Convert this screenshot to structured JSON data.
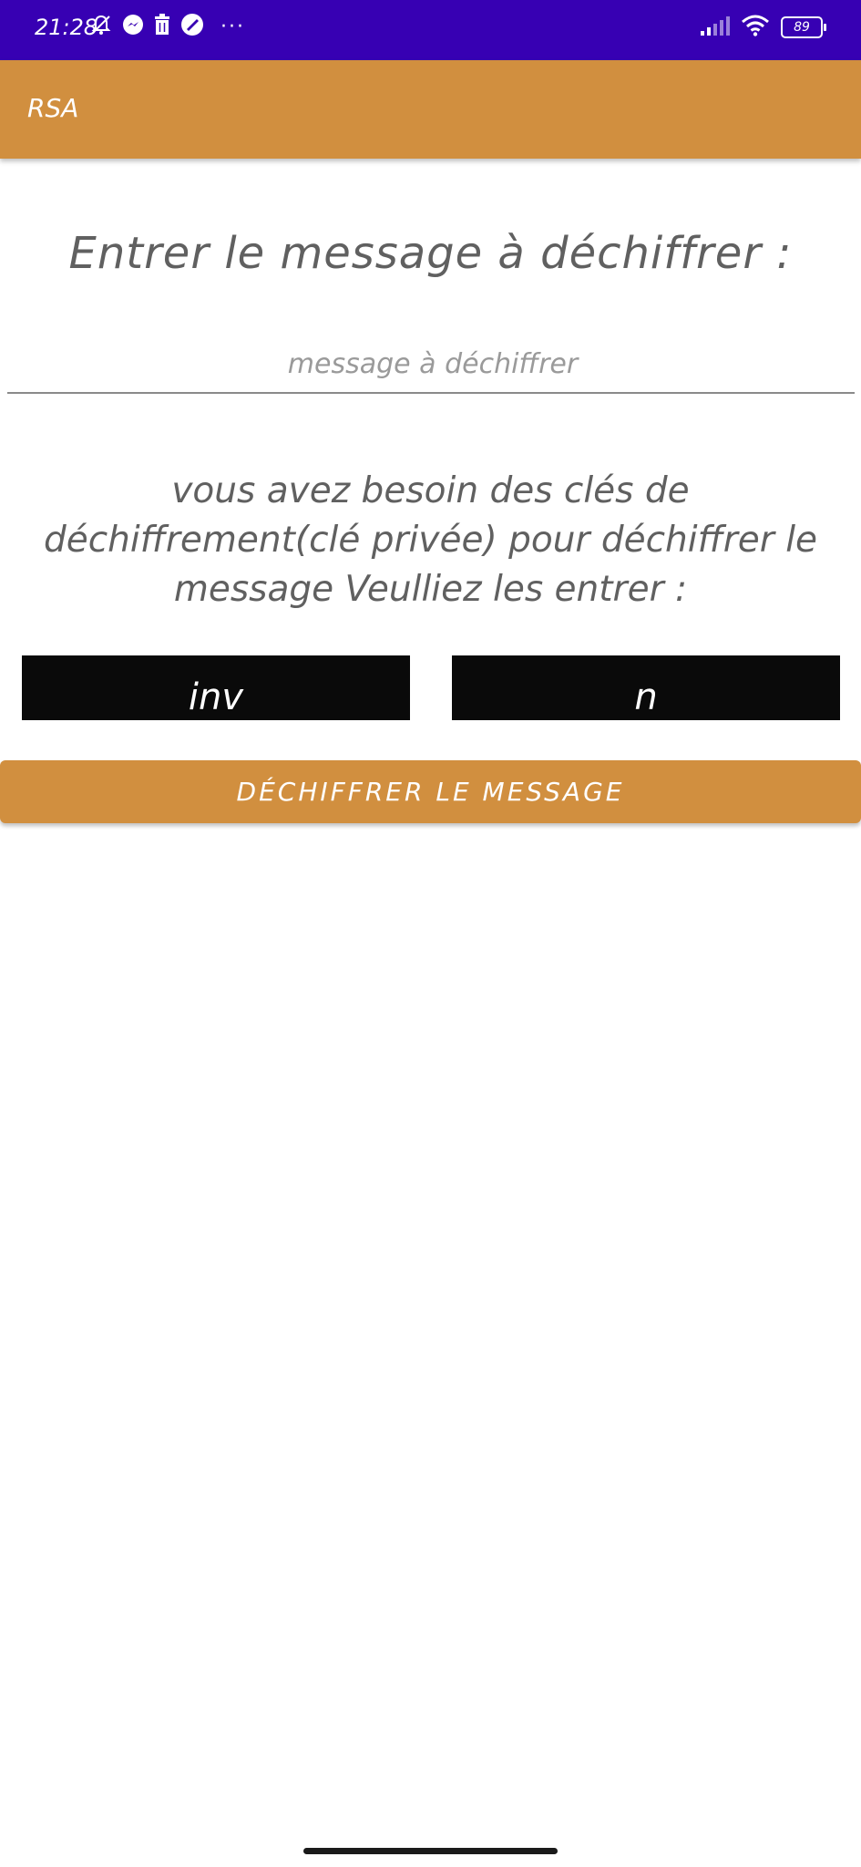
{
  "status_bar": {
    "time": "21:28",
    "battery": "89",
    "left_icons": [
      "mute-bell-icon",
      "messenger-icon",
      "trash-icon",
      "app-icon",
      "more-dots-icon"
    ],
    "right_icons": [
      "signal-icon",
      "wifi-icon",
      "battery-icon"
    ],
    "background_color": "#3700b3"
  },
  "app_bar": {
    "title": "RSA",
    "background_color": "#d18f3f"
  },
  "main": {
    "heading": "Entrer le message à déchiffrer :",
    "message_input": {
      "value": "",
      "placeholder": "message à déchiffrer"
    },
    "instructions": "vous avez besoin des clés de déchiffrement(clé privée) pour déchiffrer le message Veulliez les entrer :",
    "key_inv": {
      "value": "",
      "placeholder": "inv"
    },
    "key_n": {
      "value": "",
      "placeholder": "n"
    },
    "decrypt_button_label": "DÉCHIFFRER LE MESSAGE"
  }
}
